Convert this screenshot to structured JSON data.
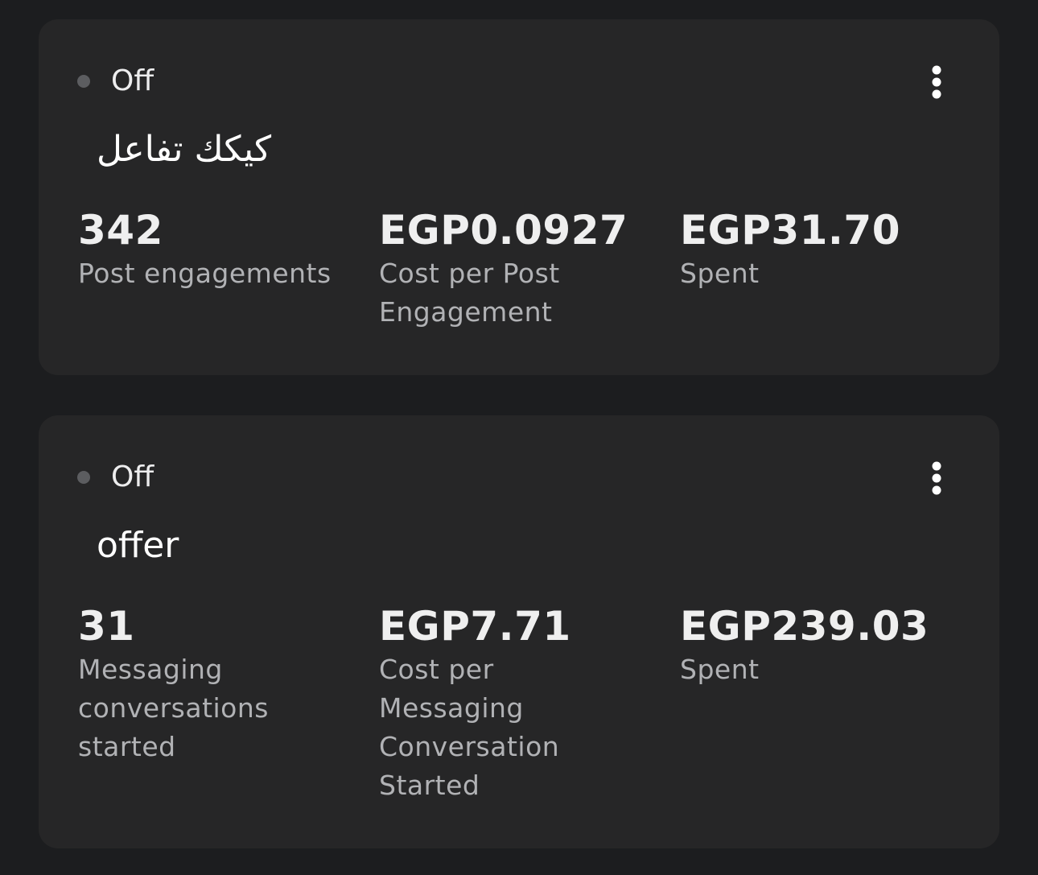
{
  "campaigns": [
    {
      "status": "Off",
      "name": "كيكك تفاعل",
      "metrics": [
        {
          "value": "342",
          "label": "Post engagements"
        },
        {
          "value": "EGP0.0927",
          "label": "Cost per Post Engagement"
        },
        {
          "value": "EGP31.70",
          "label": "Spent"
        }
      ],
      "more_icon": "more-vertical-icon"
    },
    {
      "status": "Off",
      "name": "offer",
      "metrics": [
        {
          "value": "31",
          "label": "Messaging conversations started"
        },
        {
          "value": "EGP7.71",
          "label": "Cost per Messaging Conversation Started"
        },
        {
          "value": "EGP239.03",
          "label": "Spent"
        }
      ],
      "more_icon": "more-vertical-icon"
    }
  ],
  "colors": {
    "page_background": "#1c1d1f",
    "card_background": "#262627",
    "status_dot_off": "#5c5d60",
    "value_text": "#efefef",
    "label_text": "#b1b2b5"
  }
}
